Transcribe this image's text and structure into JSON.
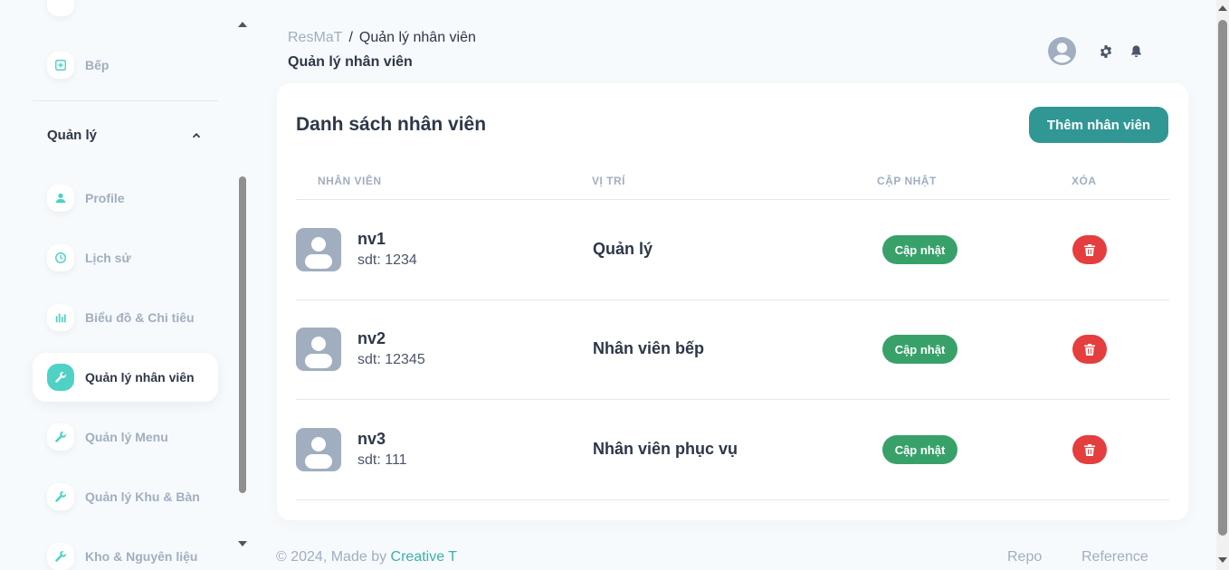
{
  "sidebar": {
    "items_top": [
      {
        "label": "Bếp",
        "icon": "plus-square-icon"
      }
    ],
    "section": {
      "title": "Quản lý",
      "icon": "chevron-up-icon"
    },
    "items": [
      {
        "label": "Profile",
        "icon": "person-icon"
      },
      {
        "label": "Lịch sử",
        "icon": "clock-icon"
      },
      {
        "label": "Biểu đồ & Chi tiêu",
        "icon": "bar-chart-icon"
      },
      {
        "label": "Quản lý nhân viên",
        "icon": "wrench-icon",
        "active": true
      },
      {
        "label": "Quản lý Menu",
        "icon": "wrench-icon"
      },
      {
        "label": "Quản lý Khu & Bàn",
        "icon": "wrench-icon"
      },
      {
        "label": "Kho & Nguyên liệu",
        "icon": "wrench-icon"
      }
    ]
  },
  "header": {
    "breadcrumb": {
      "root": "ResMaT",
      "separator": "/",
      "current": "Quản lý nhân viên"
    },
    "title": "Quản lý nhân viên",
    "icons": [
      "user-avatar-icon",
      "gear-icon",
      "bell-icon"
    ]
  },
  "card": {
    "title": "Danh sách nhân viên",
    "add_button": "Thêm nhân viên",
    "columns": [
      "NHÂN VIÊN",
      "VỊ TRÍ",
      "CẬP NHẬT",
      "XÓA"
    ],
    "rows": [
      {
        "name": "nv1",
        "phone": "sdt: 1234",
        "position": "Quản lý",
        "update_label": "Cập nhật"
      },
      {
        "name": "nv2",
        "phone": "sdt: 12345",
        "position": "Nhân viên bếp",
        "update_label": "Cập nhật"
      },
      {
        "name": "nv3",
        "phone": "sdt: 111",
        "position": "Nhân viên phục vụ",
        "update_label": "Cập nhật"
      }
    ]
  },
  "footer": {
    "copyright_prefix": "© 2024, Made by",
    "brand": "Creative T",
    "links": [
      "Repo",
      "Reference"
    ]
  },
  "colors": {
    "accent": "#4fd1c5",
    "primary_button": "#319795",
    "update_button": "#38a169",
    "delete_button": "#e53e3e"
  }
}
